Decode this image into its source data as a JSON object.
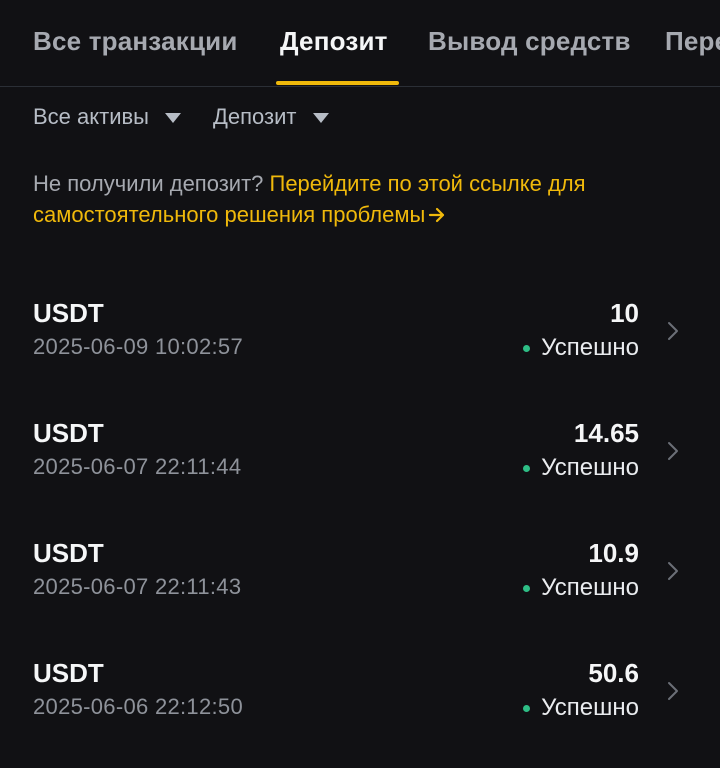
{
  "tabs": [
    {
      "label": "Все транзакции",
      "active": false
    },
    {
      "label": "Депозит",
      "active": true
    },
    {
      "label": "Вывод средств",
      "active": false
    },
    {
      "label": "Переводы",
      "active": false
    }
  ],
  "filters": {
    "asset": "Все активы",
    "type": "Депозит"
  },
  "help": {
    "text": "Не получили депозит? ",
    "link": "Перейдите по этой ссылке для самостоятельного решения проблемы"
  },
  "colors": {
    "accent": "#f0b90b",
    "success": "#2ebd85",
    "background": "#111114"
  },
  "transactions": [
    {
      "asset": "USDT",
      "time": "2025-06-09 10:02:57",
      "amount": "10",
      "status": "Успешно"
    },
    {
      "asset": "USDT",
      "time": "2025-06-07 22:11:44",
      "amount": "14.65",
      "status": "Успешно"
    },
    {
      "asset": "USDT",
      "time": "2025-06-07 22:11:43",
      "amount": "10.9",
      "status": "Успешно"
    },
    {
      "asset": "USDT",
      "time": "2025-06-06 22:12:50",
      "amount": "50.6",
      "status": "Успешно"
    }
  ]
}
